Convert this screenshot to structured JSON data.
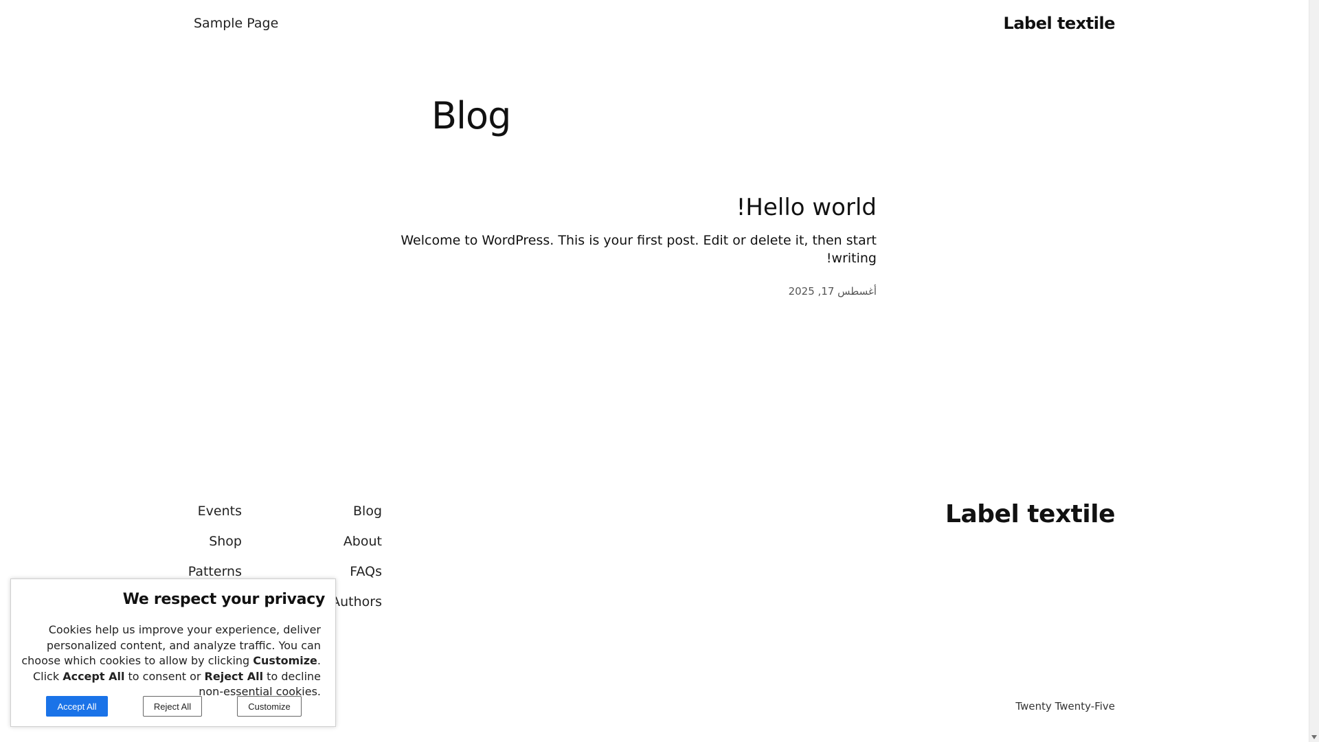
{
  "header": {
    "site_title": "Label textile",
    "nav_item": "Sample Page"
  },
  "main": {
    "page_title": "Blog",
    "post": {
      "title": "Hello world!",
      "excerpt": "Welcome to WordPress. This is your first post. Edit or delete it, then start writing!",
      "date": "أغسطس 17, 2025"
    }
  },
  "footer": {
    "site_title": "Label textile",
    "nav_col_1": [
      "Blog",
      "About",
      "FAQs",
      "Authors"
    ],
    "nav_col_2": [
      "Events",
      "Shop",
      "Patterns"
    ],
    "credit": "Twenty Twenty-Five"
  },
  "cookie": {
    "title": "We respect your privacy",
    "text_1": "Cookies help us improve your experience, deliver personalized content, and analyze traffic. You can choose which cookies to allow by clicking ",
    "strong_customize": "Customize",
    "text_2": ". Click ",
    "strong_accept": "Accept All",
    "text_3": " to consent or ",
    "strong_reject": "Reject All",
    "text_4": " to decline non-essential cookies.",
    "accept_label": "Accept All",
    "reject_label": "Reject All",
    "customize_label": "Customize",
    "accent_color": "#1a73e8"
  }
}
